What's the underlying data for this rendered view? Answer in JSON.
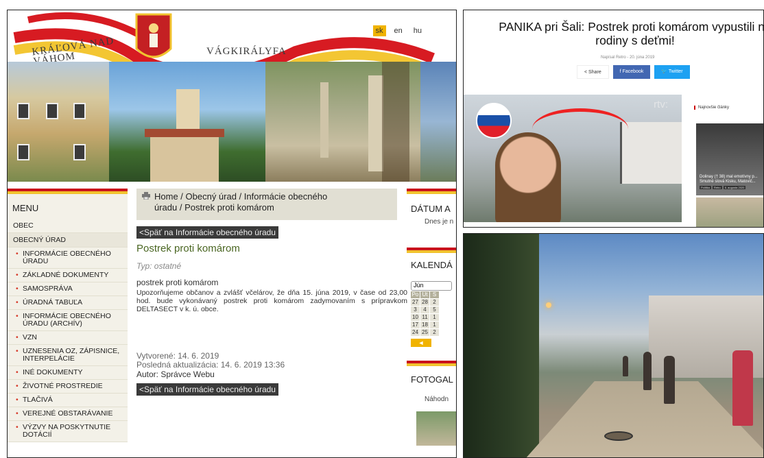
{
  "colors": {
    "accent_red": "#c9131b",
    "accent_yellow": "#f1c32e",
    "title_green": "#4a6622",
    "facebook_blue": "#4267b2",
    "twitter_blue": "#1da1f2"
  },
  "website": {
    "banner": {
      "town_name_sk": "KRÁĽOVÁ NAD VÁHOM",
      "town_name_hu": "VÁGKIRÁLYFA"
    },
    "languages": [
      "sk",
      "en",
      "hu"
    ],
    "breadcrumb": {
      "line1": "Home / Obecný úrad / Informácie obecného",
      "line2": "úradu / Postrek proti komárom"
    },
    "menu_title": "MENU",
    "menu": [
      {
        "label": "OBEC",
        "type": "top"
      },
      {
        "label": "OBECNÝ ÚRAD",
        "type": "top-strong"
      },
      {
        "label": "INFORMÁCIE OBECNÉHO ÚRADU",
        "type": "sub"
      },
      {
        "label": "ZÁKLADNÉ DOKUMENTY",
        "type": "sub"
      },
      {
        "label": "SAMOSPRÁVA",
        "type": "sub"
      },
      {
        "label": "ÚRADNÁ TABUĽA",
        "type": "sub"
      },
      {
        "label": "INFORMÁCIE OBECNÉHO ÚRADU (ARCHÍV)",
        "type": "sub"
      },
      {
        "label": "VZN",
        "type": "sub"
      },
      {
        "label": "UZNESENIA OZ, ZÁPISNICE, INTERPELÁCIE",
        "type": "sub"
      },
      {
        "label": "INÉ DOKUMENTY",
        "type": "sub"
      },
      {
        "label": "ŽIVOTNÉ PROSTREDIE",
        "type": "sub"
      },
      {
        "label": "TLAČIVÁ",
        "type": "sub"
      },
      {
        "label": "VEREJNÉ OBSTARÁVANIE",
        "type": "sub"
      },
      {
        "label": "VÝZVY NA POSKYTNUTIE DOTÁCIÍ",
        "type": "sub"
      }
    ],
    "back_link": "<Späť na Informácie obecného úradu",
    "article": {
      "title": "Postrek proti komárom",
      "type": "Typ: ostatné",
      "subtitle": "postrek proti komárom",
      "body": "Upozorňujeme občanov a zvlášť včelárov, že dňa 15. júna 2019, v čase od 23,00 hod. bude vykonávaný postrek proti komárom zadymovaním s prípravkom DELTASECT v k. ú. obce.",
      "created": "Vytvorené: 14. 6. 2019",
      "updated": "Posledná aktualizácia: 14. 6. 2019 13:36",
      "author": "Autor: Správce Webu"
    },
    "right_sidebar": {
      "date_title": "DÁTUM A",
      "date_sub": "Dnes je n",
      "calendar_title": "KALENDÁ",
      "calendar_month": "Jún",
      "calendar_head": [
        "Po",
        "Ut",
        "S"
      ],
      "calendar_rows": [
        [
          "27",
          "28",
          "2"
        ],
        [
          "3",
          "4",
          "5"
        ],
        [
          "10",
          "11",
          "1"
        ],
        [
          "17",
          "18",
          "1"
        ],
        [
          "24",
          "25",
          "2"
        ]
      ],
      "calendar_prev": "◄",
      "gallery_title": "FOTOGAL",
      "gallery_sub": "Náhodn"
    }
  },
  "news": {
    "title": "PANIKA pri Šali: Postrek proti komárom vypustili na rodiny s deťmi!",
    "byline": "Napísal Retro - 20. júna 2019",
    "share_label": "Share",
    "facebook_label": "Facebook",
    "twitter_label": "Twitter",
    "watermark": "rtv:",
    "latest_label": "Najnovšie články",
    "thumb1_text": "Dolinay († 38) mal emotívny p... Smutné slová Kisku, Matovič...",
    "thumb1_tag1": "Politika",
    "thumb1_tag2": "Retro",
    "thumb1_date": "6. augusta 2020"
  }
}
